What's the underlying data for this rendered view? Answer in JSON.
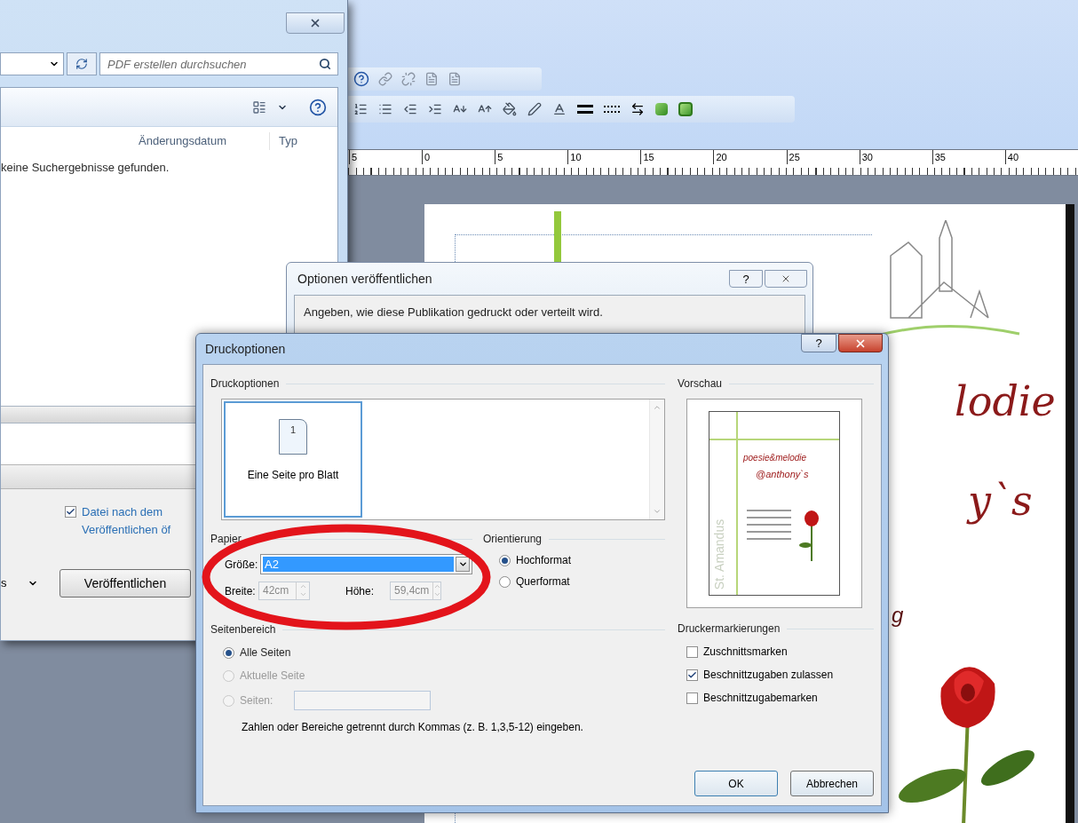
{
  "explorer": {
    "search_placeholder": "PDF erstellen durchsuchen",
    "columns": [
      "Änderungsdatum",
      "Typ"
    ],
    "empty_message": "keine Suchergebnisse gefunden.",
    "open_after_publish": {
      "label": "Datei nach dem Veröffentlichen öf",
      "checked": true
    },
    "file_type_cut": "s",
    "publish_button": "Veröffentlichen"
  },
  "ruler": [
    "5",
    "0",
    "5",
    "10",
    "15",
    "20",
    "25",
    "30",
    "35",
    "40"
  ],
  "document": {
    "texts": [
      "lodie",
      "y`s",
      "g"
    ]
  },
  "publish_options": {
    "title": "Optionen veröffentlichen",
    "help": "?",
    "description": "Angeben, wie diese Publikation gedruckt oder verteilt wird."
  },
  "print_options": {
    "title": "Druckoptionen",
    "help": "?",
    "layout_group": "Druckoptionen",
    "layouts": [
      {
        "label": "Eine Seite pro Blatt",
        "page_number": "1",
        "selected": true
      }
    ],
    "paper": {
      "heading": "Papier",
      "size_label": "Größe:",
      "size_value": "A2",
      "width_label": "Breite:",
      "width_value": "42cm",
      "height_label": "Höhe:",
      "height_value": "59,4cm"
    },
    "orientation": {
      "heading": "Orientierung",
      "options": [
        {
          "label": "Hochformat",
          "selected": true
        },
        {
          "label": "Querformat",
          "selected": false
        }
      ]
    },
    "page_range": {
      "heading": "Seitenbereich",
      "options": [
        {
          "label": "Alle Seiten",
          "selected": true,
          "disabled": false
        },
        {
          "label": "Aktuelle Seite",
          "selected": false,
          "disabled": true
        },
        {
          "label": "Seiten:",
          "selected": false,
          "disabled": true
        }
      ],
      "hint": "Zahlen oder Bereiche getrennt durch Kommas (z. B. 1,3,5-12) eingeben."
    },
    "preview": {
      "heading": "Vorschau",
      "texts": [
        "poesie&melodie",
        "@anthony`s",
        "St. Amandus"
      ]
    },
    "marks": {
      "heading": "Druckermarkierungen",
      "options": [
        {
          "label": "Zuschnittsmarken",
          "checked": false
        },
        {
          "label": "Beschnittzugaben zulassen",
          "checked": true
        },
        {
          "label": "Beschnittzugabemarken",
          "checked": false
        }
      ]
    },
    "buttons": [
      "OK",
      "Abbrechen"
    ]
  }
}
